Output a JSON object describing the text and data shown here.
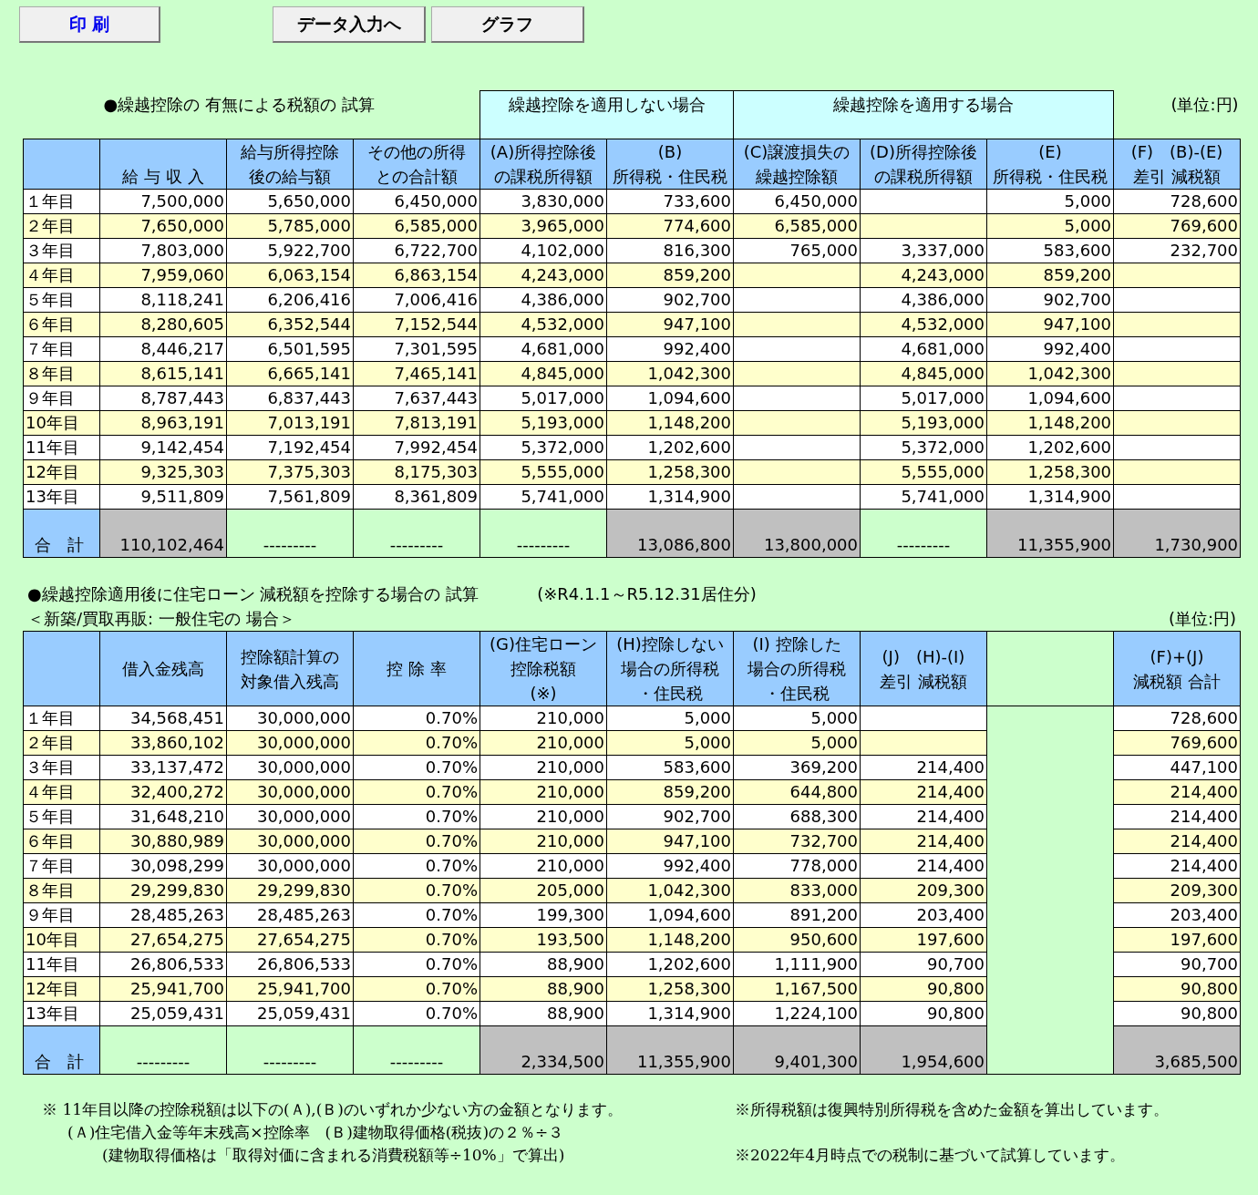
{
  "buttons": [
    {
      "label": "印 刷",
      "kind": "primary"
    },
    {
      "label": "データ入力へ",
      "kind": "normal"
    },
    {
      "label": "グラフ",
      "kind": "normal"
    }
  ],
  "section1": {
    "title": "●繰越控除の 有無による税額の 試算",
    "unit": "(単位:円)",
    "header_groups": [
      {
        "kind": "plain",
        "columns": [
          {
            "kind": "data",
            "lines": [
              "給 与 収 入"
            ]
          },
          {
            "kind": "data",
            "lines": [
              "給与所得控除",
              "後の給与額"
            ]
          },
          {
            "kind": "data",
            "lines": [
              "その他の所得",
              "との合計額"
            ]
          }
        ]
      },
      {
        "kind": "group",
        "label": "繰越控除を適用しない場合",
        "columns": [
          {
            "kind": "data",
            "lines": [
              "(A)所得控除後",
              "の課税所得額"
            ]
          },
          {
            "kind": "data",
            "lines": [
              "(B)",
              "所得税・住民税"
            ]
          }
        ]
      },
      {
        "kind": "group",
        "label": "繰越控除を適用する場合",
        "columns": [
          {
            "kind": "data",
            "lines": [
              "(C)譲渡損失の",
              "繰越控除額"
            ]
          },
          {
            "kind": "data",
            "lines": [
              "(D)所得控除後",
              "の課税所得額"
            ]
          },
          {
            "kind": "data",
            "lines": [
              "(E)",
              "所得税・住民税"
            ]
          }
        ]
      },
      {
        "kind": "plain",
        "columns": [
          {
            "kind": "data",
            "lines": [
              "(F)　(B)-(E)",
              "差引 減税額"
            ]
          }
        ]
      }
    ],
    "rows": [
      {
        "label": "１年目",
        "cells": [
          {
            "kind": "value",
            "text": "7,500,000"
          },
          {
            "kind": "value",
            "text": "5,650,000"
          },
          {
            "kind": "value",
            "text": "6,450,000"
          },
          {
            "kind": "value",
            "text": "3,830,000"
          },
          {
            "kind": "value",
            "text": "733,600"
          },
          {
            "kind": "value",
            "text": "6,450,000"
          },
          {
            "kind": "blank"
          },
          {
            "kind": "value",
            "text": "5,000"
          },
          {
            "kind": "value",
            "text": "728,600"
          }
        ]
      },
      {
        "label": "２年目",
        "cells": [
          {
            "kind": "value",
            "text": "7,650,000"
          },
          {
            "kind": "value",
            "text": "5,785,000"
          },
          {
            "kind": "value",
            "text": "6,585,000"
          },
          {
            "kind": "value",
            "text": "3,965,000"
          },
          {
            "kind": "value",
            "text": "774,600"
          },
          {
            "kind": "value",
            "text": "6,585,000"
          },
          {
            "kind": "blank"
          },
          {
            "kind": "value",
            "text": "5,000"
          },
          {
            "kind": "value",
            "text": "769,600"
          }
        ]
      },
      {
        "label": "３年目",
        "cells": [
          {
            "kind": "value",
            "text": "7,803,000"
          },
          {
            "kind": "value",
            "text": "5,922,700"
          },
          {
            "kind": "value",
            "text": "6,722,700"
          },
          {
            "kind": "value",
            "text": "4,102,000"
          },
          {
            "kind": "value",
            "text": "816,300"
          },
          {
            "kind": "value",
            "text": "765,000"
          },
          {
            "kind": "value",
            "text": "3,337,000"
          },
          {
            "kind": "value",
            "text": "583,600"
          },
          {
            "kind": "value",
            "text": "232,700"
          }
        ]
      },
      {
        "label": "４年目",
        "cells": [
          {
            "kind": "value",
            "text": "7,959,060"
          },
          {
            "kind": "value",
            "text": "6,063,154"
          },
          {
            "kind": "value",
            "text": "6,863,154"
          },
          {
            "kind": "value",
            "text": "4,243,000"
          },
          {
            "kind": "value",
            "text": "859,200"
          },
          {
            "kind": "blank"
          },
          {
            "kind": "value",
            "text": "4,243,000"
          },
          {
            "kind": "value",
            "text": "859,200"
          },
          {
            "kind": "blank"
          }
        ]
      },
      {
        "label": "５年目",
        "cells": [
          {
            "kind": "value",
            "text": "8,118,241"
          },
          {
            "kind": "value",
            "text": "6,206,416"
          },
          {
            "kind": "value",
            "text": "7,006,416"
          },
          {
            "kind": "value",
            "text": "4,386,000"
          },
          {
            "kind": "value",
            "text": "902,700"
          },
          {
            "kind": "blank"
          },
          {
            "kind": "value",
            "text": "4,386,000"
          },
          {
            "kind": "value",
            "text": "902,700"
          },
          {
            "kind": "blank"
          }
        ]
      },
      {
        "label": "６年目",
        "cells": [
          {
            "kind": "value",
            "text": "8,280,605"
          },
          {
            "kind": "value",
            "text": "6,352,544"
          },
          {
            "kind": "value",
            "text": "7,152,544"
          },
          {
            "kind": "value",
            "text": "4,532,000"
          },
          {
            "kind": "value",
            "text": "947,100"
          },
          {
            "kind": "blank"
          },
          {
            "kind": "value",
            "text": "4,532,000"
          },
          {
            "kind": "value",
            "text": "947,100"
          },
          {
            "kind": "blank"
          }
        ]
      },
      {
        "label": "７年目",
        "cells": [
          {
            "kind": "value",
            "text": "8,446,217"
          },
          {
            "kind": "value",
            "text": "6,501,595"
          },
          {
            "kind": "value",
            "text": "7,301,595"
          },
          {
            "kind": "value",
            "text": "4,681,000"
          },
          {
            "kind": "value",
            "text": "992,400"
          },
          {
            "kind": "blank"
          },
          {
            "kind": "value",
            "text": "4,681,000"
          },
          {
            "kind": "value",
            "text": "992,400"
          },
          {
            "kind": "blank"
          }
        ]
      },
      {
        "label": "８年目",
        "cells": [
          {
            "kind": "value",
            "text": "8,615,141"
          },
          {
            "kind": "value",
            "text": "6,665,141"
          },
          {
            "kind": "value",
            "text": "7,465,141"
          },
          {
            "kind": "value",
            "text": "4,845,000"
          },
          {
            "kind": "value",
            "text": "1,042,300"
          },
          {
            "kind": "blank"
          },
          {
            "kind": "value",
            "text": "4,845,000"
          },
          {
            "kind": "value",
            "text": "1,042,300"
          },
          {
            "kind": "blank"
          }
        ]
      },
      {
        "label": "９年目",
        "cells": [
          {
            "kind": "value",
            "text": "8,787,443"
          },
          {
            "kind": "value",
            "text": "6,837,443"
          },
          {
            "kind": "value",
            "text": "7,637,443"
          },
          {
            "kind": "value",
            "text": "5,017,000"
          },
          {
            "kind": "value",
            "text": "1,094,600"
          },
          {
            "kind": "blank"
          },
          {
            "kind": "value",
            "text": "5,017,000"
          },
          {
            "kind": "value",
            "text": "1,094,600"
          },
          {
            "kind": "blank"
          }
        ]
      },
      {
        "label": "10年目",
        "cells": [
          {
            "kind": "value",
            "text": "8,963,191"
          },
          {
            "kind": "value",
            "text": "7,013,191"
          },
          {
            "kind": "value",
            "text": "7,813,191"
          },
          {
            "kind": "value",
            "text": "5,193,000"
          },
          {
            "kind": "value",
            "text": "1,148,200"
          },
          {
            "kind": "blank"
          },
          {
            "kind": "value",
            "text": "5,193,000"
          },
          {
            "kind": "value",
            "text": "1,148,200"
          },
          {
            "kind": "blank"
          }
        ]
      },
      {
        "label": "11年目",
        "cells": [
          {
            "kind": "value",
            "text": "9,142,454"
          },
          {
            "kind": "value",
            "text": "7,192,454"
          },
          {
            "kind": "value",
            "text": "7,992,454"
          },
          {
            "kind": "value",
            "text": "5,372,000"
          },
          {
            "kind": "value",
            "text": "1,202,600"
          },
          {
            "kind": "blank"
          },
          {
            "kind": "value",
            "text": "5,372,000"
          },
          {
            "kind": "value",
            "text": "1,202,600"
          },
          {
            "kind": "blank"
          }
        ]
      },
      {
        "label": "12年目",
        "cells": [
          {
            "kind": "value",
            "text": "9,325,303"
          },
          {
            "kind": "value",
            "text": "7,375,303"
          },
          {
            "kind": "value",
            "text": "8,175,303"
          },
          {
            "kind": "value",
            "text": "5,555,000"
          },
          {
            "kind": "value",
            "text": "1,258,300"
          },
          {
            "kind": "blank"
          },
          {
            "kind": "value",
            "text": "5,555,000"
          },
          {
            "kind": "value",
            "text": "1,258,300"
          },
          {
            "kind": "blank"
          }
        ]
      },
      {
        "label": "13年目",
        "cells": [
          {
            "kind": "value",
            "text": "9,511,809"
          },
          {
            "kind": "value",
            "text": "7,561,809"
          },
          {
            "kind": "value",
            "text": "8,361,809"
          },
          {
            "kind": "value",
            "text": "5,741,000"
          },
          {
            "kind": "value",
            "text": "1,314,900"
          },
          {
            "kind": "blank"
          },
          {
            "kind": "value",
            "text": "5,741,000"
          },
          {
            "kind": "value",
            "text": "1,314,900"
          },
          {
            "kind": "blank"
          }
        ]
      }
    ],
    "total": {
      "label": "合　計",
      "cells": [
        {
          "text": "110,102,464",
          "shaded": true
        },
        {
          "text": "---------",
          "shaded": false
        },
        {
          "text": "---------",
          "shaded": false
        },
        {
          "text": "---------",
          "shaded": false
        },
        {
          "text": "13,086,800",
          "shaded": true
        },
        {
          "text": "13,800,000",
          "shaded": true
        },
        {
          "text": "---------",
          "shaded": false
        },
        {
          "text": "11,355,900",
          "shaded": true
        },
        {
          "text": "1,730,900",
          "shaded": true
        }
      ]
    }
  },
  "section2": {
    "title": "●繰越控除適用後に住宅ローン 減税額を控除する場合の 試算",
    "note": "(※R4.1.1～R5.12.31居住分)",
    "subtitle": "＜新築/買取再販: 一般住宅の 場合＞",
    "unit": "(単位:円)",
    "columns": [
      {
        "kind": "data",
        "lines": [
          "借入金残高"
        ]
      },
      {
        "kind": "data",
        "lines": [
          "控除額計算の",
          "対象借入残高"
        ]
      },
      {
        "kind": "data",
        "lines": [
          "控 除 率"
        ]
      },
      {
        "kind": "data",
        "lines": [
          "(G)住宅ローン",
          "控除税額",
          "(※)"
        ]
      },
      {
        "kind": "data",
        "lines": [
          "(H)控除しない",
          "場合の所得税",
          "・住民税"
        ]
      },
      {
        "kind": "data",
        "lines": [
          "(I) 控除した",
          "場合の所得税",
          "・住民税"
        ]
      },
      {
        "kind": "data",
        "lines": [
          "(J)　(H)-(I)",
          "差引 減税額"
        ]
      },
      {
        "kind": "spacer"
      },
      {
        "kind": "data",
        "lines": [
          "(F)+(J)",
          "減税額 合計"
        ]
      }
    ],
    "rows": [
      {
        "label": "１年目",
        "cells": [
          {
            "kind": "value",
            "text": "34,568,451"
          },
          {
            "kind": "value",
            "text": "30,000,000"
          },
          {
            "kind": "value",
            "text": "0.70%"
          },
          {
            "kind": "value",
            "text": "210,000"
          },
          {
            "kind": "value",
            "text": "5,000"
          },
          {
            "kind": "value",
            "text": "5,000"
          },
          {
            "kind": "blank"
          },
          {
            "kind": "spacer"
          },
          {
            "kind": "value",
            "text": "728,600"
          }
        ]
      },
      {
        "label": "２年目",
        "cells": [
          {
            "kind": "value",
            "text": "33,860,102"
          },
          {
            "kind": "value",
            "text": "30,000,000"
          },
          {
            "kind": "value",
            "text": "0.70%"
          },
          {
            "kind": "value",
            "text": "210,000"
          },
          {
            "kind": "value",
            "text": "5,000"
          },
          {
            "kind": "value",
            "text": "5,000"
          },
          {
            "kind": "blank"
          },
          {
            "kind": "spacer"
          },
          {
            "kind": "value",
            "text": "769,600"
          }
        ]
      },
      {
        "label": "３年目",
        "cells": [
          {
            "kind": "value",
            "text": "33,137,472"
          },
          {
            "kind": "value",
            "text": "30,000,000"
          },
          {
            "kind": "value",
            "text": "0.70%"
          },
          {
            "kind": "value",
            "text": "210,000"
          },
          {
            "kind": "value",
            "text": "583,600"
          },
          {
            "kind": "value",
            "text": "369,200"
          },
          {
            "kind": "value",
            "text": "214,400"
          },
          {
            "kind": "spacer"
          },
          {
            "kind": "value",
            "text": "447,100"
          }
        ]
      },
      {
        "label": "４年目",
        "cells": [
          {
            "kind": "value",
            "text": "32,400,272"
          },
          {
            "kind": "value",
            "text": "30,000,000"
          },
          {
            "kind": "value",
            "text": "0.70%"
          },
          {
            "kind": "value",
            "text": "210,000"
          },
          {
            "kind": "value",
            "text": "859,200"
          },
          {
            "kind": "value",
            "text": "644,800"
          },
          {
            "kind": "value",
            "text": "214,400"
          },
          {
            "kind": "spacer"
          },
          {
            "kind": "value",
            "text": "214,400"
          }
        ]
      },
      {
        "label": "５年目",
        "cells": [
          {
            "kind": "value",
            "text": "31,648,210"
          },
          {
            "kind": "value",
            "text": "30,000,000"
          },
          {
            "kind": "value",
            "text": "0.70%"
          },
          {
            "kind": "value",
            "text": "210,000"
          },
          {
            "kind": "value",
            "text": "902,700"
          },
          {
            "kind": "value",
            "text": "688,300"
          },
          {
            "kind": "value",
            "text": "214,400"
          },
          {
            "kind": "spacer"
          },
          {
            "kind": "value",
            "text": "214,400"
          }
        ]
      },
      {
        "label": "６年目",
        "cells": [
          {
            "kind": "value",
            "text": "30,880,989"
          },
          {
            "kind": "value",
            "text": "30,000,000"
          },
          {
            "kind": "value",
            "text": "0.70%"
          },
          {
            "kind": "value",
            "text": "210,000"
          },
          {
            "kind": "value",
            "text": "947,100"
          },
          {
            "kind": "value",
            "text": "732,700"
          },
          {
            "kind": "value",
            "text": "214,400"
          },
          {
            "kind": "spacer"
          },
          {
            "kind": "value",
            "text": "214,400"
          }
        ]
      },
      {
        "label": "７年目",
        "cells": [
          {
            "kind": "value",
            "text": "30,098,299"
          },
          {
            "kind": "value",
            "text": "30,000,000"
          },
          {
            "kind": "value",
            "text": "0.70%"
          },
          {
            "kind": "value",
            "text": "210,000"
          },
          {
            "kind": "value",
            "text": "992,400"
          },
          {
            "kind": "value",
            "text": "778,000"
          },
          {
            "kind": "value",
            "text": "214,400"
          },
          {
            "kind": "spacer"
          },
          {
            "kind": "value",
            "text": "214,400"
          }
        ]
      },
      {
        "label": "８年目",
        "cells": [
          {
            "kind": "value",
            "text": "29,299,830"
          },
          {
            "kind": "value",
            "text": "29,299,830"
          },
          {
            "kind": "value",
            "text": "0.70%"
          },
          {
            "kind": "value",
            "text": "205,000"
          },
          {
            "kind": "value",
            "text": "1,042,300"
          },
          {
            "kind": "value",
            "text": "833,000"
          },
          {
            "kind": "value",
            "text": "209,300"
          },
          {
            "kind": "spacer"
          },
          {
            "kind": "value",
            "text": "209,300"
          }
        ]
      },
      {
        "label": "９年目",
        "cells": [
          {
            "kind": "value",
            "text": "28,485,263"
          },
          {
            "kind": "value",
            "text": "28,485,263"
          },
          {
            "kind": "value",
            "text": "0.70%"
          },
          {
            "kind": "value",
            "text": "199,300"
          },
          {
            "kind": "value",
            "text": "1,094,600"
          },
          {
            "kind": "value",
            "text": "891,200"
          },
          {
            "kind": "value",
            "text": "203,400"
          },
          {
            "kind": "spacer"
          },
          {
            "kind": "value",
            "text": "203,400"
          }
        ]
      },
      {
        "label": "10年目",
        "cells": [
          {
            "kind": "value",
            "text": "27,654,275"
          },
          {
            "kind": "value",
            "text": "27,654,275"
          },
          {
            "kind": "value",
            "text": "0.70%"
          },
          {
            "kind": "value",
            "text": "193,500"
          },
          {
            "kind": "value",
            "text": "1,148,200"
          },
          {
            "kind": "value",
            "text": "950,600"
          },
          {
            "kind": "value",
            "text": "197,600"
          },
          {
            "kind": "spacer"
          },
          {
            "kind": "value",
            "text": "197,600"
          }
        ]
      },
      {
        "label": "11年目",
        "cells": [
          {
            "kind": "value",
            "text": "26,806,533"
          },
          {
            "kind": "value",
            "text": "26,806,533"
          },
          {
            "kind": "value",
            "text": "0.70%"
          },
          {
            "kind": "value",
            "text": "88,900"
          },
          {
            "kind": "value",
            "text": "1,202,600"
          },
          {
            "kind": "value",
            "text": "1,111,900"
          },
          {
            "kind": "value",
            "text": "90,700"
          },
          {
            "kind": "spacer"
          },
          {
            "kind": "value",
            "text": "90,700"
          }
        ]
      },
      {
        "label": "12年目",
        "cells": [
          {
            "kind": "value",
            "text": "25,941,700"
          },
          {
            "kind": "value",
            "text": "25,941,700"
          },
          {
            "kind": "value",
            "text": "0.70%"
          },
          {
            "kind": "value",
            "text": "88,900"
          },
          {
            "kind": "value",
            "text": "1,258,300"
          },
          {
            "kind": "value",
            "text": "1,167,500"
          },
          {
            "kind": "value",
            "text": "90,800"
          },
          {
            "kind": "spacer"
          },
          {
            "kind": "value",
            "text": "90,800"
          }
        ]
      },
      {
        "label": "13年目",
        "cells": [
          {
            "kind": "value",
            "text": "25,059,431"
          },
          {
            "kind": "value",
            "text": "25,059,431"
          },
          {
            "kind": "value",
            "text": "0.70%"
          },
          {
            "kind": "value",
            "text": "88,900"
          },
          {
            "kind": "value",
            "text": "1,314,900"
          },
          {
            "kind": "value",
            "text": "1,224,100"
          },
          {
            "kind": "value",
            "text": "90,800"
          },
          {
            "kind": "spacer"
          },
          {
            "kind": "value",
            "text": "90,800"
          }
        ]
      }
    ],
    "total": {
      "label": "合　計",
      "cells": [
        {
          "kind": "value",
          "text": "---------",
          "shaded": false
        },
        {
          "kind": "value",
          "text": "---------",
          "shaded": false
        },
        {
          "kind": "value",
          "text": "---------",
          "shaded": false
        },
        {
          "kind": "value",
          "text": "2,334,500",
          "shaded": true
        },
        {
          "kind": "value",
          "text": "11,355,900",
          "shaded": true
        },
        {
          "kind": "value",
          "text": "9,401,300",
          "shaded": true
        },
        {
          "kind": "value",
          "text": "1,954,600",
          "shaded": true
        },
        {
          "kind": "spacer"
        },
        {
          "kind": "value",
          "text": "3,685,500",
          "shaded": true
        }
      ]
    }
  },
  "notes_left": [
    "※ 11年目以降の控除税額は以下の(Ａ),(Ｂ)のいずれか少ない方の金額となります。",
    "(Ａ)住宅借入金等年末残高×控除率　(Ｂ)建物取得価格(税抜)の２％÷３",
    "(建物取得価格は「取得対価に含まれる消費税額等÷10%」で算出)"
  ],
  "notes_right": [
    "※所得税額は復興特別所得税を含めた金額を算出しています。",
    "※2022年4月時点での税制に基づいて試算しています。"
  ]
}
